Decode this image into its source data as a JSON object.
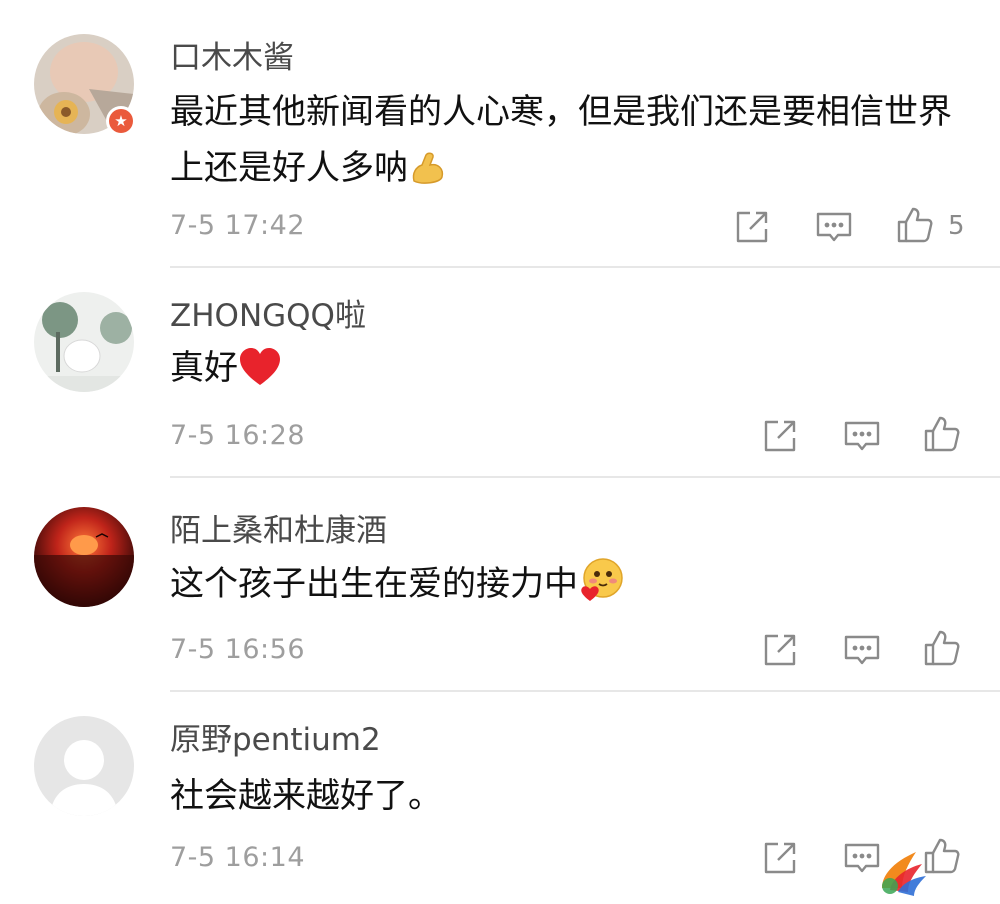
{
  "comments": [
    {
      "username": "口木木酱",
      "text": "最近其他新闻看的人心寒，但是我们还是要相信世界上还是好人多呐",
      "emoji": "flexed-biceps",
      "time": "7-5 17:42",
      "likes": "5",
      "verified_badge": "★"
    },
    {
      "username": "ZHONGQQ啦",
      "text": "真好",
      "emoji": "red-heart",
      "time": "7-5 16:28",
      "likes": ""
    },
    {
      "username": "陌上桑和杜康酒",
      "text": "这个孩子出生在爱的接力中",
      "emoji": "smiling-face-with-heart",
      "time": "7-5 16:56",
      "likes": ""
    },
    {
      "username": "原野pentium2",
      "text": "社会越来越好了。",
      "time": "7-5 16:14",
      "likes": ""
    }
  ],
  "icons": {
    "share": "share-icon",
    "comment": "comment-icon",
    "like": "thumbs-up-icon"
  },
  "colors": {
    "username": "#4a4a4a",
    "text": "#111111",
    "time": "#9e9e9e",
    "icon": "#8a8a8a",
    "divider": "#e7e7e7",
    "badge": "#ea5a3c"
  }
}
